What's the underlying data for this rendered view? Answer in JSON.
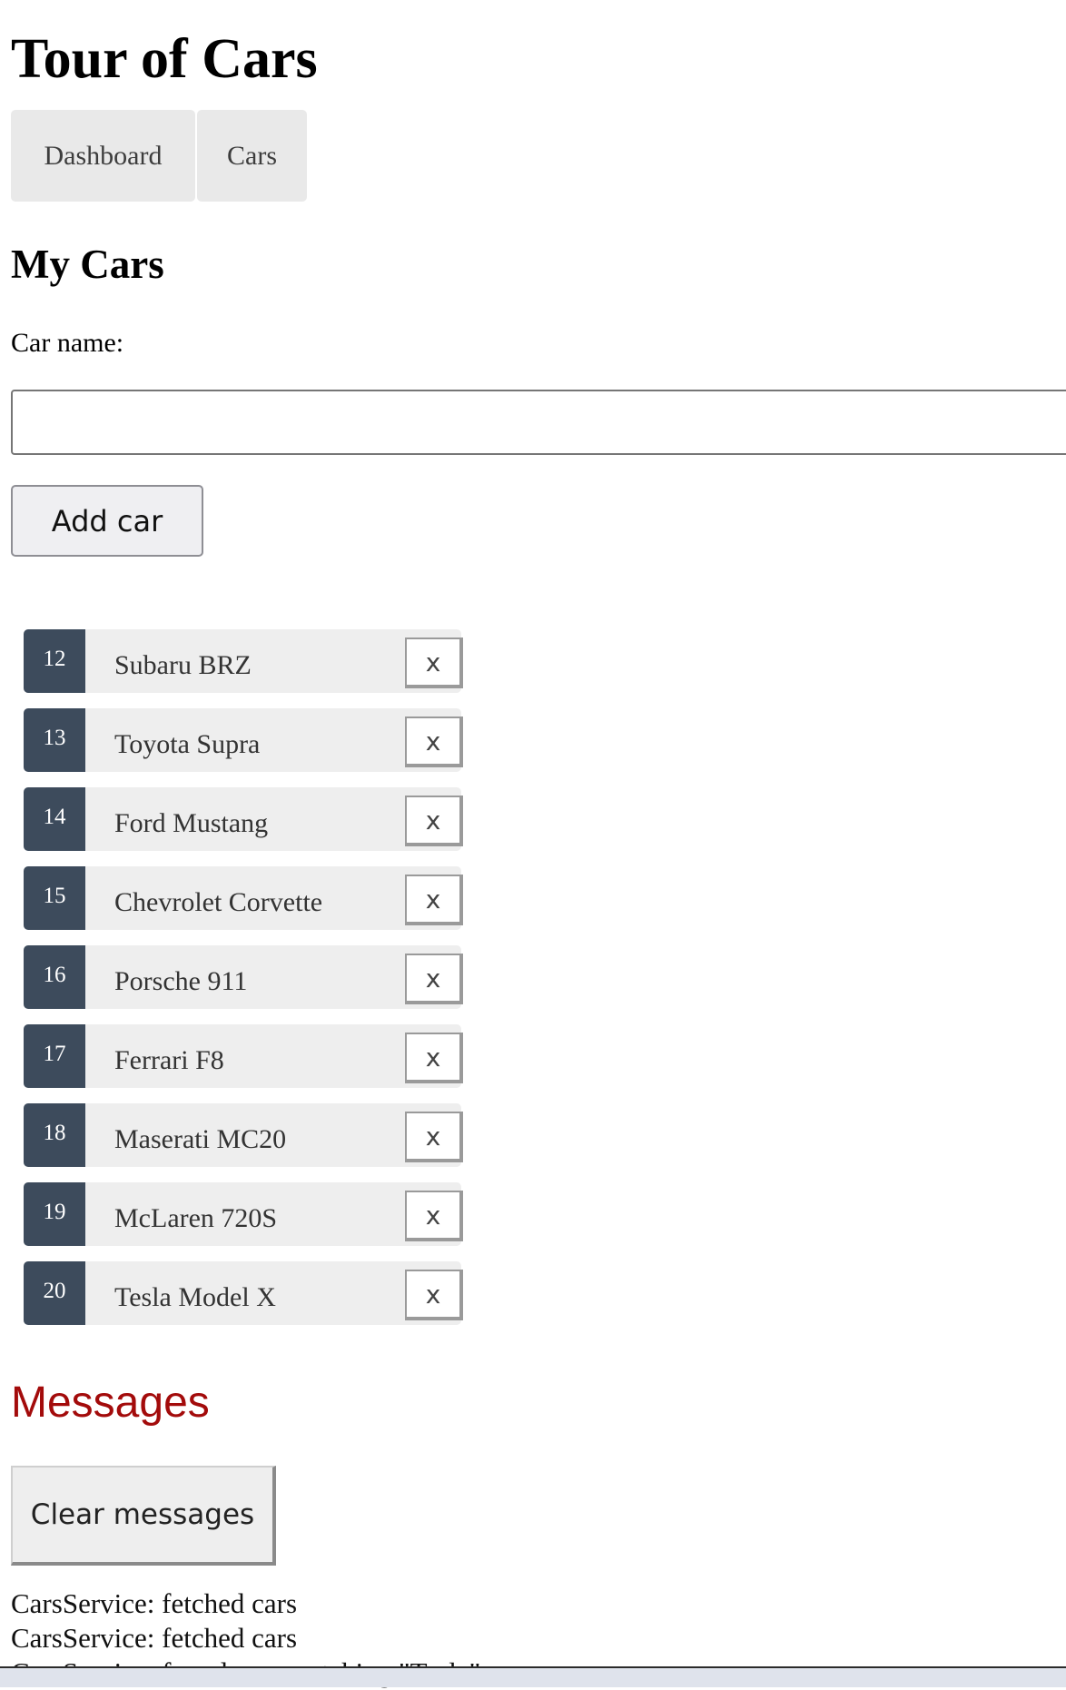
{
  "app": {
    "title": "Tour of Cars"
  },
  "nav": {
    "items": [
      {
        "label": "Dashboard"
      },
      {
        "label": "Cars"
      }
    ]
  },
  "cars_page": {
    "heading": "My Cars",
    "name_label": "Car name:",
    "name_value": "",
    "add_button_label": "Add car",
    "delete_label": "x"
  },
  "cars": [
    {
      "id": "12",
      "name": "Subaru BRZ"
    },
    {
      "id": "13",
      "name": "Toyota Supra"
    },
    {
      "id": "14",
      "name": "Ford Mustang"
    },
    {
      "id": "15",
      "name": "Chevrolet Corvette"
    },
    {
      "id": "16",
      "name": "Porsche 911"
    },
    {
      "id": "17",
      "name": "Ferrari F8"
    },
    {
      "id": "18",
      "name": "Maserati MC20"
    },
    {
      "id": "19",
      "name": "McLaren 720S"
    },
    {
      "id": "20",
      "name": "Tesla Model X"
    }
  ],
  "messages": {
    "heading": "Messages",
    "clear_button_label": "Clear messages",
    "items": [
      "CarsService: fetched cars",
      "CarsService: fetched cars",
      "CarsService: found cars matching \"Tesla\""
    ]
  },
  "colors": {
    "id_badge": "#3d4b5c",
    "row_background": "#eeeeee",
    "messages_heading": "#a30b0b",
    "nav_background": "#e9e9e9"
  }
}
